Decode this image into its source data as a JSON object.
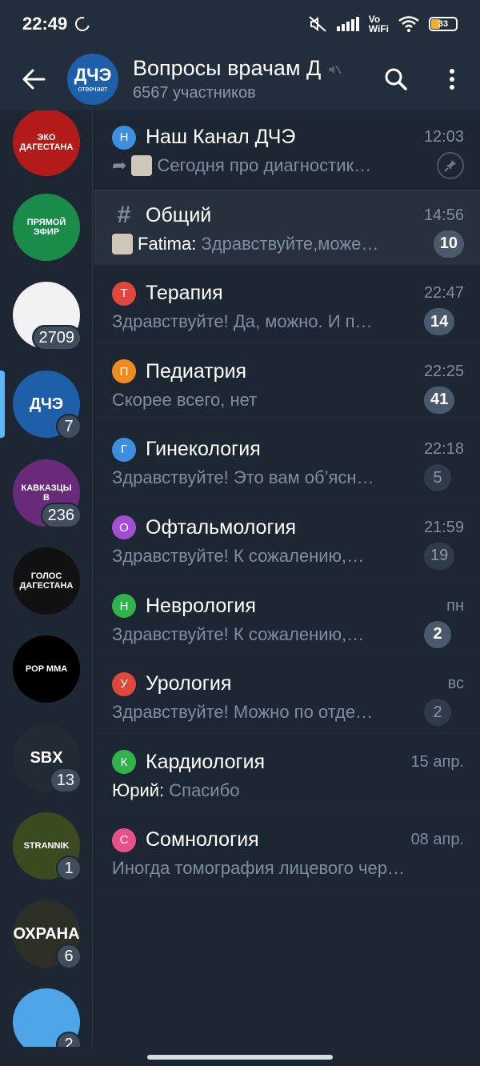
{
  "status": {
    "time": "22:49",
    "battery": "33",
    "network": "Vo\nWiFi"
  },
  "header": {
    "title": "Вопросы врачам Д",
    "subtitle": "6567 участников",
    "avatar_text": "ДЧЭ",
    "avatar_sub": "отвечает"
  },
  "sidebar": [
    {
      "label": "ЭКО ДАГЕСТАНА",
      "badge": "",
      "color": "#b31b1b"
    },
    {
      "label": "ПРЯМОЙ ЭФИР",
      "badge": "",
      "color": "#1a8c4a"
    },
    {
      "label": "",
      "badge": "2709",
      "color": "#f2f2f2"
    },
    {
      "label": "ДЧЭ",
      "badge": "7",
      "color": "#1d5fa8",
      "active": true
    },
    {
      "label": "КАВКАЗЦЫ В",
      "badge": "236",
      "color": "#6a2a7a"
    },
    {
      "label": "ГОЛОС ДАГЕСТАНА",
      "badge": "",
      "color": "#111111"
    },
    {
      "label": "POP MMA",
      "badge": "",
      "color": "#000000"
    },
    {
      "label": "SBX",
      "badge": "13",
      "color": "#222a33"
    },
    {
      "label": "STRANNIK",
      "badge": "1",
      "color": "#3b4a1f"
    },
    {
      "label": "ОХРАНА",
      "badge": "6",
      "color": "#2b2f26"
    },
    {
      "label": "",
      "badge": "2",
      "color": "#4ea6e8"
    }
  ],
  "topics": [
    {
      "icon": "Н",
      "icon_color": "#3e8ee0",
      "title": "Наш Канал ДЧЭ",
      "time": "12:03",
      "sender": "",
      "message": "Сегодня про диагностик…",
      "count": "",
      "pinned": true,
      "forwarded": true,
      "thumb": true
    },
    {
      "icon": "#",
      "icon_color": "",
      "title": "Общий",
      "time": "14:56",
      "sender": "Fatima: ",
      "message": "Здравствуйте,може…",
      "count": "10",
      "muted": false,
      "highlight": true,
      "thumb": true
    },
    {
      "icon": "Т",
      "icon_color": "#e0463b",
      "title": "Терапия",
      "time": "22:47",
      "sender": "",
      "message": "Здравствуйте! Да, можно. И п…",
      "count": "14",
      "muted": false
    },
    {
      "icon": "П",
      "icon_color": "#f08c1c",
      "title": "Педиатрия",
      "time": "22:25",
      "sender": "",
      "message": "Скорее всего, нет",
      "count": "41",
      "muted": false
    },
    {
      "icon": "Г",
      "icon_color": "#3e8ee0",
      "title": "Гинекология",
      "time": "22:18",
      "sender": "",
      "message": "Здравствуйте! Это вам об’ясн…",
      "count": "5",
      "muted": true
    },
    {
      "icon": "О",
      "icon_color": "#a24fd6",
      "title": "Офтальмология",
      "time": "21:59",
      "sender": "",
      "message": "Здравствуйте! К сожалению,…",
      "count": "19",
      "muted": true
    },
    {
      "icon": "Н",
      "icon_color": "#2fb34a",
      "title": "Неврология",
      "time": "пн",
      "sender": "",
      "message": "Здравствуйте! К сожалению,…",
      "count": "2",
      "muted": false
    },
    {
      "icon": "У",
      "icon_color": "#e0463b",
      "title": "Урология",
      "time": "вс",
      "sender": "",
      "message": "Здравствуйте! Можно по отде…",
      "count": "2",
      "muted": true
    },
    {
      "icon": "К",
      "icon_color": "#2fb34a",
      "title": "Кардиология",
      "time": "15 апр.",
      "sender": "Юрий: ",
      "message": "Спасибо",
      "count": ""
    },
    {
      "icon": "С",
      "icon_color": "#e8508a",
      "title": "Сомнология",
      "time": "08 апр.",
      "sender": "",
      "message": "Иногда томография лицевого чер…",
      "count": ""
    }
  ]
}
